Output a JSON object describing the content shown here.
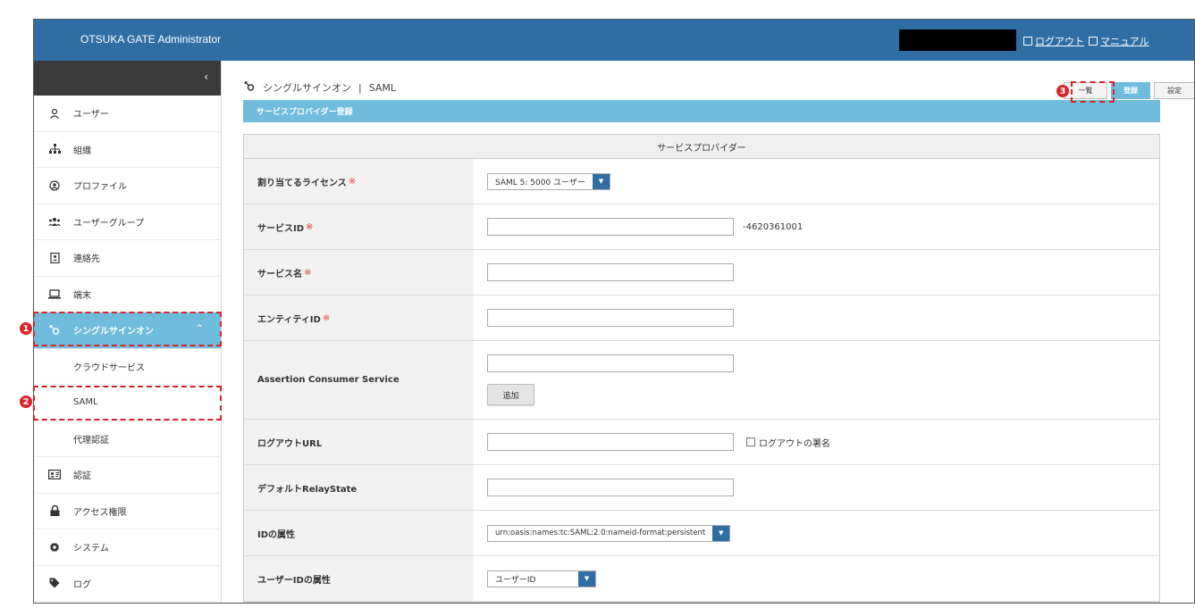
{
  "header": {
    "app_title": "OTSUKA GATE Administrator",
    "logout_label": "ログアウト",
    "manual_label": "マニュアル"
  },
  "sidebar": {
    "collapse_glyph": "‹",
    "items": [
      {
        "label": "ユーザー",
        "icon": "user-icon"
      },
      {
        "label": "組織",
        "icon": "org-chart-icon"
      },
      {
        "label": "プロファイル",
        "icon": "profile-icon"
      },
      {
        "label": "ユーザーグループ",
        "icon": "users-group-icon"
      },
      {
        "label": "連絡先",
        "icon": "contact-book-icon"
      },
      {
        "label": "端末",
        "icon": "laptop-icon"
      },
      {
        "label": "シングルサインオン",
        "icon": "sso-icon",
        "active": true
      },
      {
        "label": "認証",
        "icon": "id-card-icon"
      },
      {
        "label": "アクセス権限",
        "icon": "lock-icon"
      },
      {
        "label": "システム",
        "icon": "gear-icon"
      },
      {
        "label": "ログ",
        "icon": "tag-icon"
      }
    ],
    "sso_caret": "^",
    "sub_items": [
      "クラウドサービス",
      "SAML",
      "代理認証"
    ]
  },
  "annotations": {
    "m1": "1",
    "m2": "2",
    "m3": "3"
  },
  "main": {
    "breadcrumb_section": "シングルサインオン",
    "breadcrumb_sep": "|",
    "breadcrumb_page": "SAML",
    "tabs": {
      "list": "一覧",
      "register": "登録",
      "settings": "設定"
    },
    "banner": "サービスプロバイダー登録",
    "form_header": "サービスプロバイダー",
    "required_mark": "※",
    "fields": {
      "license_label": "割り当てるライセンス",
      "license_value": "SAML 5: 5000 ユーザー",
      "service_id_label": "サービスID",
      "service_id_suffix": "-4620361001",
      "service_name_label": "サービス名",
      "entity_id_label": "エンティティID",
      "acs_label": "Assertion Consumer Service",
      "add_button": "追加",
      "logout_url_label": "ログアウトURL",
      "logout_sign_label": "ログアウトの署名",
      "relay_state_label": "デフォルトRelayState",
      "id_attr_label": "IDの属性",
      "id_attr_value": "urn:oasis:names:tc:SAML:2.0:nameid-format:persistent",
      "user_id_attr_label": "ユーザーIDの属性",
      "user_id_attr_value": "ユーザーID"
    }
  },
  "colors": {
    "topbar": "#2f6ea5",
    "accent": "#6fbcdc",
    "marker": "#d9242b"
  }
}
